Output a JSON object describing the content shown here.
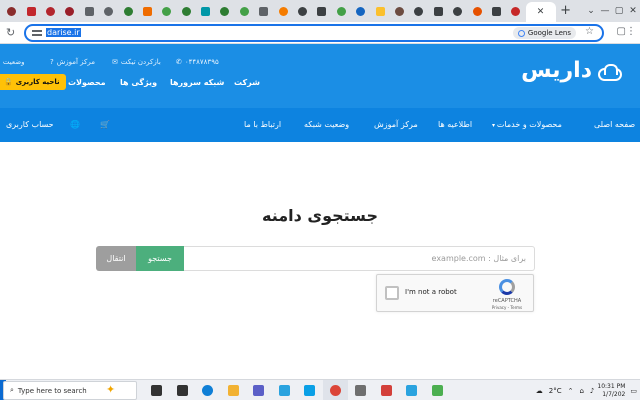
{
  "browser": {
    "tab_favicons": [
      {
        "name": "favicon-1",
        "color": "#8a2c2c"
      },
      {
        "name": "favicon-2",
        "color": "#c2272d"
      },
      {
        "name": "favicon-3",
        "color": "#b3262e"
      },
      {
        "name": "favicon-4",
        "color": "#9a1f2a"
      },
      {
        "name": "favicon-5",
        "color": "#5f6368"
      },
      {
        "name": "favicon-6",
        "color": "#5f6368"
      },
      {
        "name": "favicon-7",
        "color": "#2e7d32"
      },
      {
        "name": "favicon-8",
        "color": "#ef6c00"
      },
      {
        "name": "favicon-9",
        "color": "#43a047"
      },
      {
        "name": "favicon-10",
        "color": "#2e7d32"
      },
      {
        "name": "favicon-11",
        "color": "#0097a7"
      },
      {
        "name": "favicon-12",
        "color": "#2e7d32"
      },
      {
        "name": "favicon-13",
        "color": "#43a047"
      },
      {
        "name": "favicon-14",
        "color": "#5f6368"
      },
      {
        "name": "favicon-15",
        "color": "#f57c00"
      },
      {
        "name": "favicon-16",
        "color": "#3c4043"
      },
      {
        "name": "favicon-17",
        "color": "#3c4043"
      },
      {
        "name": "favicon-18",
        "color": "#43a047"
      },
      {
        "name": "favicon-19",
        "color": "#1565c0"
      },
      {
        "name": "favicon-20",
        "color": "#fbc02d"
      },
      {
        "name": "favicon-21",
        "color": "#6d4c41"
      },
      {
        "name": "favicon-22",
        "color": "#3c4043"
      },
      {
        "name": "favicon-23",
        "color": "#3c4043"
      },
      {
        "name": "favicon-24",
        "color": "#3c4043"
      },
      {
        "name": "favicon-25",
        "color": "#e65100"
      },
      {
        "name": "favicon-26",
        "color": "#3c4043"
      },
      {
        "name": "favicon-27",
        "color": "#c62828"
      }
    ],
    "active_tab_close": "✕",
    "new_tab": "+",
    "window_controls": [
      "⌄",
      "—",
      "▢",
      "✕"
    ],
    "url": "darise.ir",
    "lens_label": "Google Lens"
  },
  "site": {
    "logo": "داریس",
    "topbar": {
      "phone": "۰۴۴۸۷۸۳۹۵",
      "ticket": "بازکردن تیکت",
      "learning": "مرکز آموزش",
      "status": "وضعیت"
    },
    "mainnav": {
      "company": "شرکت",
      "server_network": "شبکه سرورها",
      "features": "ویژگی ها",
      "products": "محصولات"
    },
    "client_area": "ناحیه کاربری",
    "subnav": {
      "home": "صفحه اصلی",
      "products_services": "محصولات و خدمات",
      "announcements": "اطلاعیه ها",
      "learning_center": "مرکز آموزش",
      "network_status": "وضعیت شبکه",
      "contact": "ارتباط با ما",
      "account": "حساب کاربری"
    },
    "domain_search": {
      "title": "جستجوی دامنه",
      "placeholder": "برای مثال : example.com",
      "search_button": "جستجو",
      "transfer_button": "انتقال"
    },
    "recaptcha": {
      "label": "I'm not a robot",
      "brand": "reCAPTCHA",
      "links": "Privacy - Terms"
    }
  },
  "taskbar": {
    "search_placeholder": "Type here to search",
    "apps": [
      {
        "name": "task-view",
        "color": "#333333"
      },
      {
        "name": "mail",
        "color": "#333333"
      },
      {
        "name": "edge",
        "color": "#0f7fd6"
      },
      {
        "name": "file-explorer",
        "color": "#f2b233"
      },
      {
        "name": "store",
        "color": "#5b5fc7"
      },
      {
        "name": "telegram",
        "color": "#2aa3df"
      },
      {
        "name": "skype",
        "color": "#0aa0e6"
      },
      {
        "name": "chrome",
        "color": "#db4437"
      },
      {
        "name": "app-9",
        "color": "#6f6f6f"
      },
      {
        "name": "app-10",
        "color": "#d3403a"
      },
      {
        "name": "telegram-2",
        "color": "#2aa3df"
      },
      {
        "name": "app-12",
        "color": "#4caf50"
      }
    ],
    "weather": "2°C",
    "time": "10:31 PM",
    "date": "1/7/202"
  }
}
